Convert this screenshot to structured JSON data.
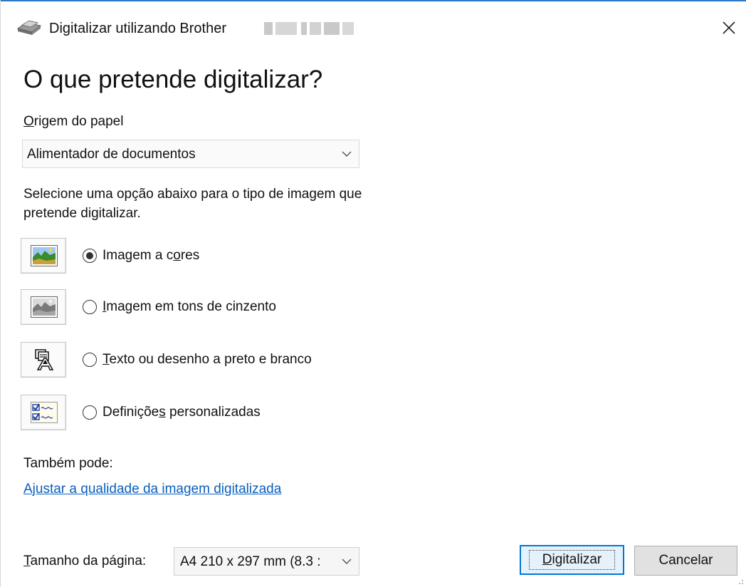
{
  "window": {
    "title": "Digitalizar utilizando Brother",
    "close_glyph": "✕"
  },
  "heading": "O que pretende digitalizar?",
  "paper_source": {
    "label_mnemonic": "O",
    "label_rest": "rigem do papel",
    "value": "Alimentador de documentos"
  },
  "description": "Selecione uma opção abaixo para o tipo de imagem que pretende digitalizar.",
  "options": [
    {
      "pre": "Imagem a c",
      "mn": "o",
      "post": "res",
      "selected": true,
      "icon": "color-picture-icon"
    },
    {
      "pre": "",
      "mn": "I",
      "post": "magem em tons de cinzento",
      "selected": false,
      "icon": "grayscale-picture-icon"
    },
    {
      "pre": "",
      "mn": "T",
      "post": "exto ou desenho a preto e branco",
      "selected": false,
      "icon": "text-drawing-icon"
    },
    {
      "pre": "Definiçõe",
      "mn": "s",
      "post": " personalizadas",
      "selected": false,
      "icon": "custom-settings-icon"
    }
  ],
  "also": {
    "label": "Também pode:",
    "link": "Ajustar a qualidade da imagem digitalizada"
  },
  "page_size": {
    "label_mnemonic": "T",
    "label_rest": "amanho da página:",
    "value": "A4 210 x 297 mm (8.3 :"
  },
  "buttons": {
    "scan_mnemonic": "D",
    "scan_rest": "igitalizar",
    "cancel": "Cancelar"
  },
  "colors": {
    "accent": "#0078d7",
    "link": "#0b5fbd",
    "title_bar_line": "#2b78c4"
  }
}
